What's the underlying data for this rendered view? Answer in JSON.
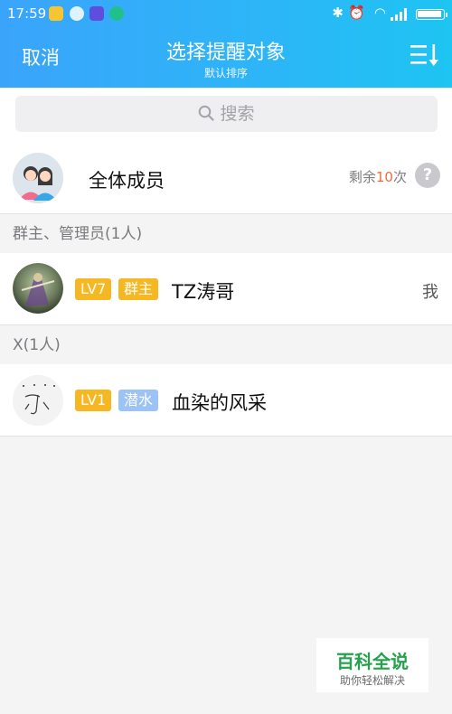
{
  "status_bar": {
    "time": "17:59"
  },
  "header": {
    "cancel_label": "取消",
    "title": "选择提醒对象",
    "subtitle": "默认排序",
    "sort_icon": "sort-list-icon"
  },
  "search": {
    "placeholder": "搜索"
  },
  "all_members": {
    "label": "全体成员",
    "remaining_prefix": "剩余",
    "remaining_count": "10",
    "remaining_suffix": "次",
    "help": "?"
  },
  "sections": [
    {
      "title": "群主、管理员(1人)",
      "members": [
        {
          "level": "LV7",
          "role": "群主",
          "name": "TZ涛哥",
          "tag": "我",
          "level_color": "#f5b722",
          "role_color": "#f5b722"
        }
      ]
    },
    {
      "title": "X(1人)",
      "members": [
        {
          "level": "LV1",
          "role": "潜水",
          "name": "血染的风采",
          "level_color": "#f5b722",
          "role_color": "#9cc3f5"
        }
      ]
    }
  ],
  "watermark": {
    "main": "百科全说",
    "sub": "助你轻松解决"
  },
  "colors": {
    "header_start": "#3aa4fb",
    "header_end": "#1ec4f2",
    "accent_orange": "#f46a3f"
  }
}
